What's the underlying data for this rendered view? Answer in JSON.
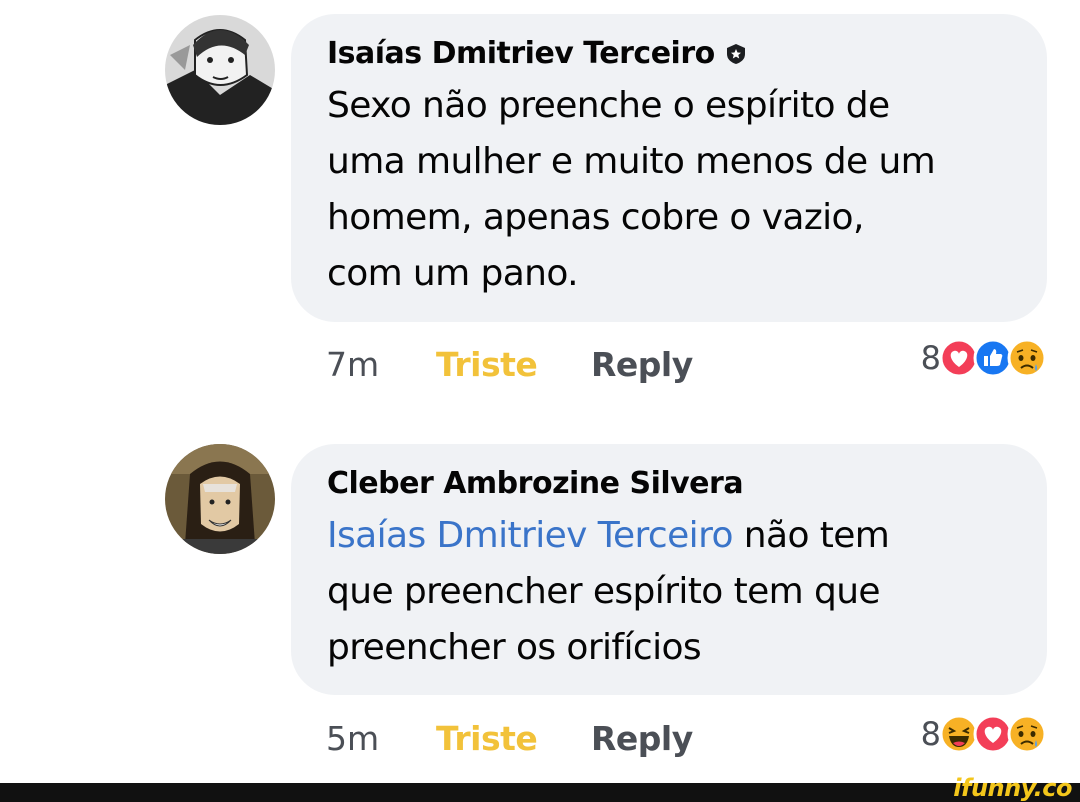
{
  "comments": [
    {
      "author": "Isaías Dmitriev Terceiro",
      "has_badge": true,
      "mention": "",
      "text_lines": [
        "Sexo não preenche o espírito de",
        "uma mulher e muito menos de um",
        "homem, apenas cobre o vazio,",
        "com um pano."
      ],
      "time": "7m",
      "reaction_label": "Triste",
      "reply_label": "Reply",
      "reaction_count": "8",
      "reaction_icons": [
        "love-reaction-icon",
        "like-reaction-icon",
        "sad-reaction-icon"
      ]
    },
    {
      "author": "Cleber Ambrozine Silvera",
      "has_badge": false,
      "mention": "Isaías Dmitriev Terceiro",
      "text_first_rest": " não tem",
      "text_lines": [
        "que preencher espírito tem que",
        "preencher os orifícios"
      ],
      "time": "5m",
      "reaction_label": "Triste",
      "reply_label": "Reply",
      "reaction_count": "8",
      "reaction_icons": [
        "haha-reaction-icon",
        "love-reaction-icon",
        "sad-reaction-icon"
      ]
    }
  ],
  "footer": {
    "watermark": "ifunny.co"
  },
  "colors": {
    "bubble": "#f0f2f5",
    "mention": "#3a74c9",
    "triste": "#f2c23a",
    "meta": "#4b4f56"
  }
}
